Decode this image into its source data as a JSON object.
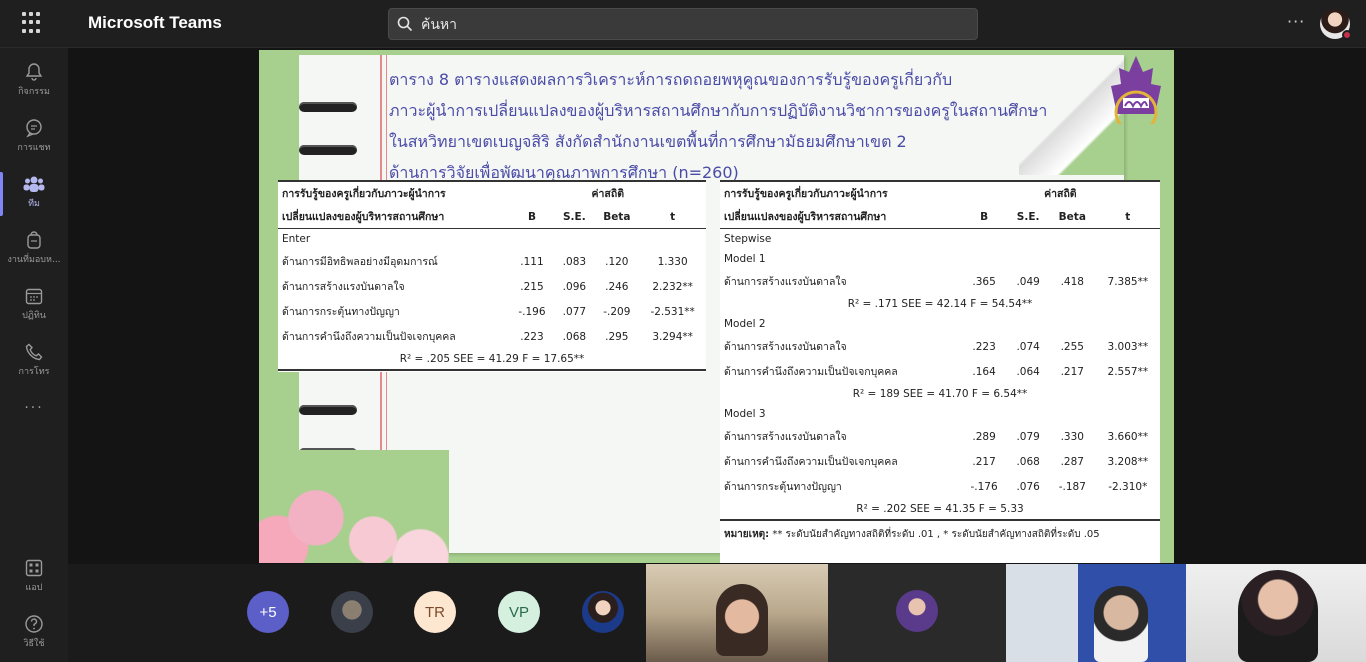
{
  "app": {
    "title": "Microsoft Teams"
  },
  "search": {
    "placeholder": "ค้นหา"
  },
  "top_more": "···",
  "rail": {
    "items": [
      {
        "label": "กิจกรรม",
        "icon": "bell-icon"
      },
      {
        "label": "การแชท",
        "icon": "chat-icon"
      },
      {
        "label": "ทีม",
        "icon": "teams-icon"
      },
      {
        "label": "งานที่มอบห...",
        "icon": "assignments-icon"
      },
      {
        "label": "ปฏิทิน",
        "icon": "calendar-icon"
      },
      {
        "label": "การโทร",
        "icon": "phone-icon"
      },
      {
        "label": "แอป",
        "icon": "apps-icon"
      },
      {
        "label": "วิธีใช้",
        "icon": "help-icon"
      }
    ],
    "more": "···"
  },
  "slide": {
    "title_lines": [
      "ตาราง 8 ตารางแสดงผลการวิเคราะห์การถดถอยพหุคูณของการรับรู้ของครูเกี่ยวกับ",
      "ภาวะผู้นำการเปลี่ยนแปลงของผู้บริหารสถานศึกษากับการปฏิบัติงานวิชาการของครูในสถานศึกษา",
      "ในสหวิทยาเขตเบญจสิริ สังกัดสำนักงานเขตพื้นที่การศึกษามัธยมศึกษาเขต 2",
      "ด้านการวิจัยเพื่อพัฒนาคุณภาพการศึกษา (n=260)"
    ],
    "table1": {
      "header_left_1": "การรับรู้ของครูเกี่ยวกับภาวะผู้นำการ",
      "header_left_2": "เปลี่ยนแปลงของผู้บริหารสถานศึกษา",
      "header_stats": "ค่าสถิติ",
      "cols": [
        "B",
        "S.E.",
        "Beta",
        "t"
      ],
      "method": "Enter",
      "rows": [
        {
          "name": "ด้านการมีอิทธิพลอย่างมีอุดมการณ์",
          "b": ".111",
          "se": ".083",
          "beta": ".120",
          "t": "1.330"
        },
        {
          "name": "ด้านการสร้างแรงบันดาลใจ",
          "b": ".215",
          "se": ".096",
          "beta": ".246",
          "t": "2.232**"
        },
        {
          "name": "ด้านการกระตุ้นทางปัญญา",
          "b": "-.196",
          "se": ".077",
          "beta": "-.209",
          "t": "-2.531**"
        },
        {
          "name": "ด้านการคำนึงถึงความเป็นปัจเจกบุคคล",
          "b": ".223",
          "se": ".068",
          "beta": ".295",
          "t": "3.294**"
        }
      ],
      "stats": "R² = .205      SEE = 41.29      F = 17.65**"
    },
    "table2": {
      "header_left_1": "การรับรู้ของครูเกี่ยวกับภาวะผู้นำการ",
      "header_left_2": "เปลี่ยนแปลงของผู้บริหารสถานศึกษา",
      "header_stats": "ค่าสถิติ",
      "cols": [
        "B",
        "S.E.",
        "Beta",
        "t"
      ],
      "method": "Stepwise",
      "models": [
        {
          "label": "Model 1",
          "rows": [
            {
              "name": "ด้านการสร้างแรงบันดาลใจ",
              "b": ".365",
              "se": ".049",
              "beta": ".418",
              "t": "7.385**"
            }
          ],
          "stats": "R² =  .171   SEE = 42.14     F = 54.54**"
        },
        {
          "label": "Model 2",
          "rows": [
            {
              "name": "ด้านการสร้างแรงบันดาลใจ",
              "b": ".223",
              "se": ".074",
              "beta": ".255",
              "t": "3.003**"
            },
            {
              "name": "ด้านการคำนึงถึงความเป็นปัจเจกบุคคล",
              "b": ".164",
              "se": ".064",
              "beta": ".217",
              "t": "2.557**"
            }
          ],
          "stats": "R² =  189   SEE = 41.70     F = 6.54**"
        },
        {
          "label": "Model 3",
          "rows": [
            {
              "name": "ด้านการสร้างแรงบันดาลใจ",
              "b": ".289",
              "se": ".079",
              "beta": ".330",
              "t": "3.660**"
            },
            {
              "name": "ด้านการคำนึงถึงความเป็นปัจเจกบุคคล",
              "b": ".217",
              "se": ".068",
              "beta": ".287",
              "t": "3.208**"
            },
            {
              "name": "ด้านการกระตุ้นทางปัญญา",
              "b": "-.176",
              "se": ".076",
              "beta": "-.187",
              "t": "-2.310*"
            }
          ],
          "stats": "R² =  .202   SEE = 41.35     F = 5.33"
        }
      ],
      "note_label": "หมายเหตุ:",
      "note_text": " ** ระดับนัยสำคัญทางสถิติที่ระดับ .01 , * ระดับนัยสำคัญทางสถิติที่ระดับ .05"
    }
  },
  "participants": {
    "more_count": "+5",
    "initials": [
      "TR",
      "VP"
    ]
  },
  "colors": {
    "accent": "#5b5fc7",
    "slide_bg": "#a7cf8e",
    "title_text": "#4b4ba8"
  }
}
